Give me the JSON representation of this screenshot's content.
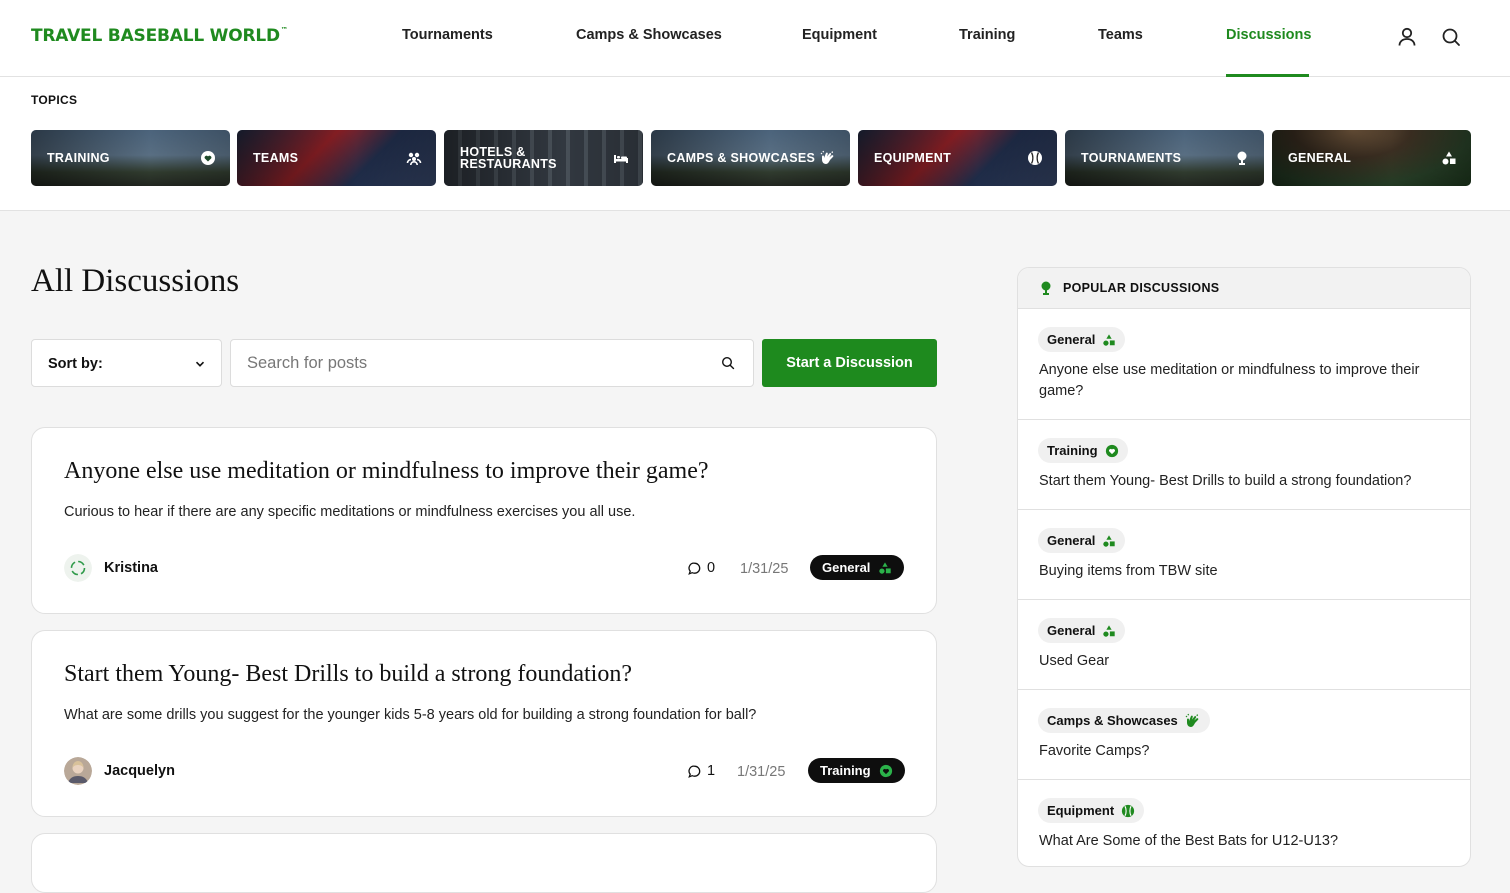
{
  "header": {
    "logo": "TRAVEL BASEBALL WORLD",
    "logo_tm": "™",
    "nav": [
      {
        "label": "Tournaments",
        "active": false
      },
      {
        "label": "Camps & Showcases",
        "active": false
      },
      {
        "label": "Equipment",
        "active": false
      },
      {
        "label": "Training",
        "active": false
      },
      {
        "label": "Teams",
        "active": false
      },
      {
        "label": "Discussions",
        "active": true
      }
    ],
    "icons": [
      "user-icon",
      "search-icon"
    ]
  },
  "topics": {
    "title": "TOPICS",
    "items": [
      {
        "label": "TRAINING",
        "icon": "heart-icon"
      },
      {
        "label": "TEAMS",
        "icon": "group-icon"
      },
      {
        "label": "HOTELS &\nRESTAURANTS",
        "icon": "bed-icon"
      },
      {
        "label": "CAMPS & SHOWCASES",
        "icon": "clapping-hand-icon"
      },
      {
        "label": "EQUIPMENT",
        "icon": "baseball-icon"
      },
      {
        "label": "TOURNAMENTS",
        "icon": "trophy-icon"
      },
      {
        "label": "GENERAL",
        "icon": "shapes-icon"
      }
    ]
  },
  "main": {
    "title": "All Discussions",
    "sort_label": "Sort by:",
    "search_placeholder": "Search for posts",
    "start_button": "Start a Discussion",
    "posts": [
      {
        "title": "Anyone else use meditation or mindfulness to improve their game?",
        "body": "Curious to hear if there are any specific meditations or mindfulness exercises you all use.",
        "author": "Kristina",
        "comments": "0",
        "date": "1/31/25",
        "category": "General"
      },
      {
        "title": "Start them Young- Best Drills to build a strong foundation?",
        "body": "What are some drills you suggest for the younger kids 5-8 years old for building a strong foundation for ball?",
        "author": "Jacquelyn",
        "comments": "1",
        "date": "1/31/25",
        "category": "Training"
      }
    ]
  },
  "sidebar": {
    "title": "POPULAR DISCUSSIONS",
    "items": [
      {
        "category": "General",
        "text": "Anyone else use meditation or mindfulness to improve their game?"
      },
      {
        "category": "Training",
        "text": "Start them Young- Best Drills to build a strong foundation?"
      },
      {
        "category": "General",
        "text": "Buying items from TBW site"
      },
      {
        "category": "General",
        "text": "Used Gear"
      },
      {
        "category": "Camps & Showcases",
        "text": "Favorite Camps?"
      },
      {
        "category": "Equipment",
        "text": "What Are Some of the Best Bats for U12-U13?"
      }
    ]
  },
  "colors": {
    "brand_green": "#1f8a1f",
    "button_green": "#1e8a1e",
    "badge_dark": "#0e0e0e"
  }
}
